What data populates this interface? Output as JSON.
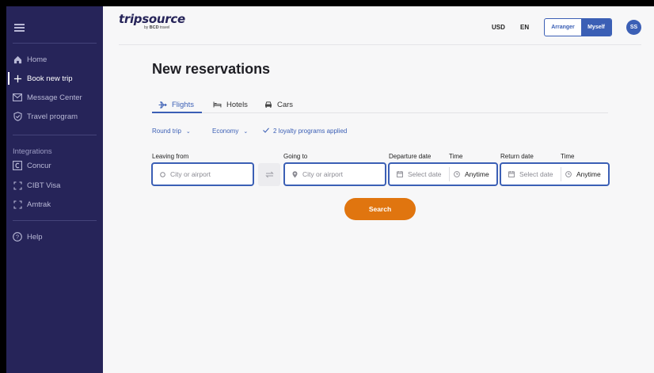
{
  "brand": {
    "name": "tripsource",
    "sub_prefix": "by",
    "sub_brand": "BCD",
    "sub_suffix": "travel"
  },
  "sidebar": {
    "items": [
      {
        "label": "Home",
        "icon": "home-icon"
      },
      {
        "label": "Book new trip",
        "icon": "plus-icon"
      },
      {
        "label": "Message Center",
        "icon": "mail-icon"
      },
      {
        "label": "Travel program",
        "icon": "shield-icon"
      }
    ],
    "integrations_label": "Integrations",
    "integrations": [
      {
        "label": "Concur",
        "icon": "concur-icon"
      },
      {
        "label": "CIBT Visa",
        "icon": "bracket-icon"
      },
      {
        "label": "Amtrak",
        "icon": "bracket-icon"
      }
    ],
    "help_label": "Help"
  },
  "header": {
    "currency": "USD",
    "language": "EN",
    "role_options": [
      "Arranger",
      "Myself"
    ],
    "selected_role": "Myself",
    "avatar_initials": "SS"
  },
  "main": {
    "title": "New reservations",
    "tabs": [
      {
        "label": "Flights",
        "icon": "plane-icon"
      },
      {
        "label": "Hotels",
        "icon": "bed-icon"
      },
      {
        "label": "Cars",
        "icon": "car-icon"
      }
    ],
    "active_tab": "Flights",
    "options": {
      "trip_type": "Round trip",
      "cabin_class": "Economy",
      "loyalty": "2 loyalty programs applied"
    },
    "form": {
      "leaving_label": "Leaving from",
      "leaving_placeholder": "City or airport",
      "going_label": "Going to",
      "going_placeholder": "City or airport",
      "departure_label": "Departure date",
      "departure_placeholder": "Select date",
      "departure_time_label": "Time",
      "departure_time_value": "Anytime",
      "return_label": "Return date",
      "return_placeholder": "Select date",
      "return_time_label": "Time",
      "return_time_value": "Anytime"
    },
    "search_label": "Search"
  },
  "colors": {
    "sidebar_bg": "#262459",
    "accent": "#3b5fb5",
    "search_button": "#e0750f",
    "page_bg": "#f7f7f8"
  }
}
